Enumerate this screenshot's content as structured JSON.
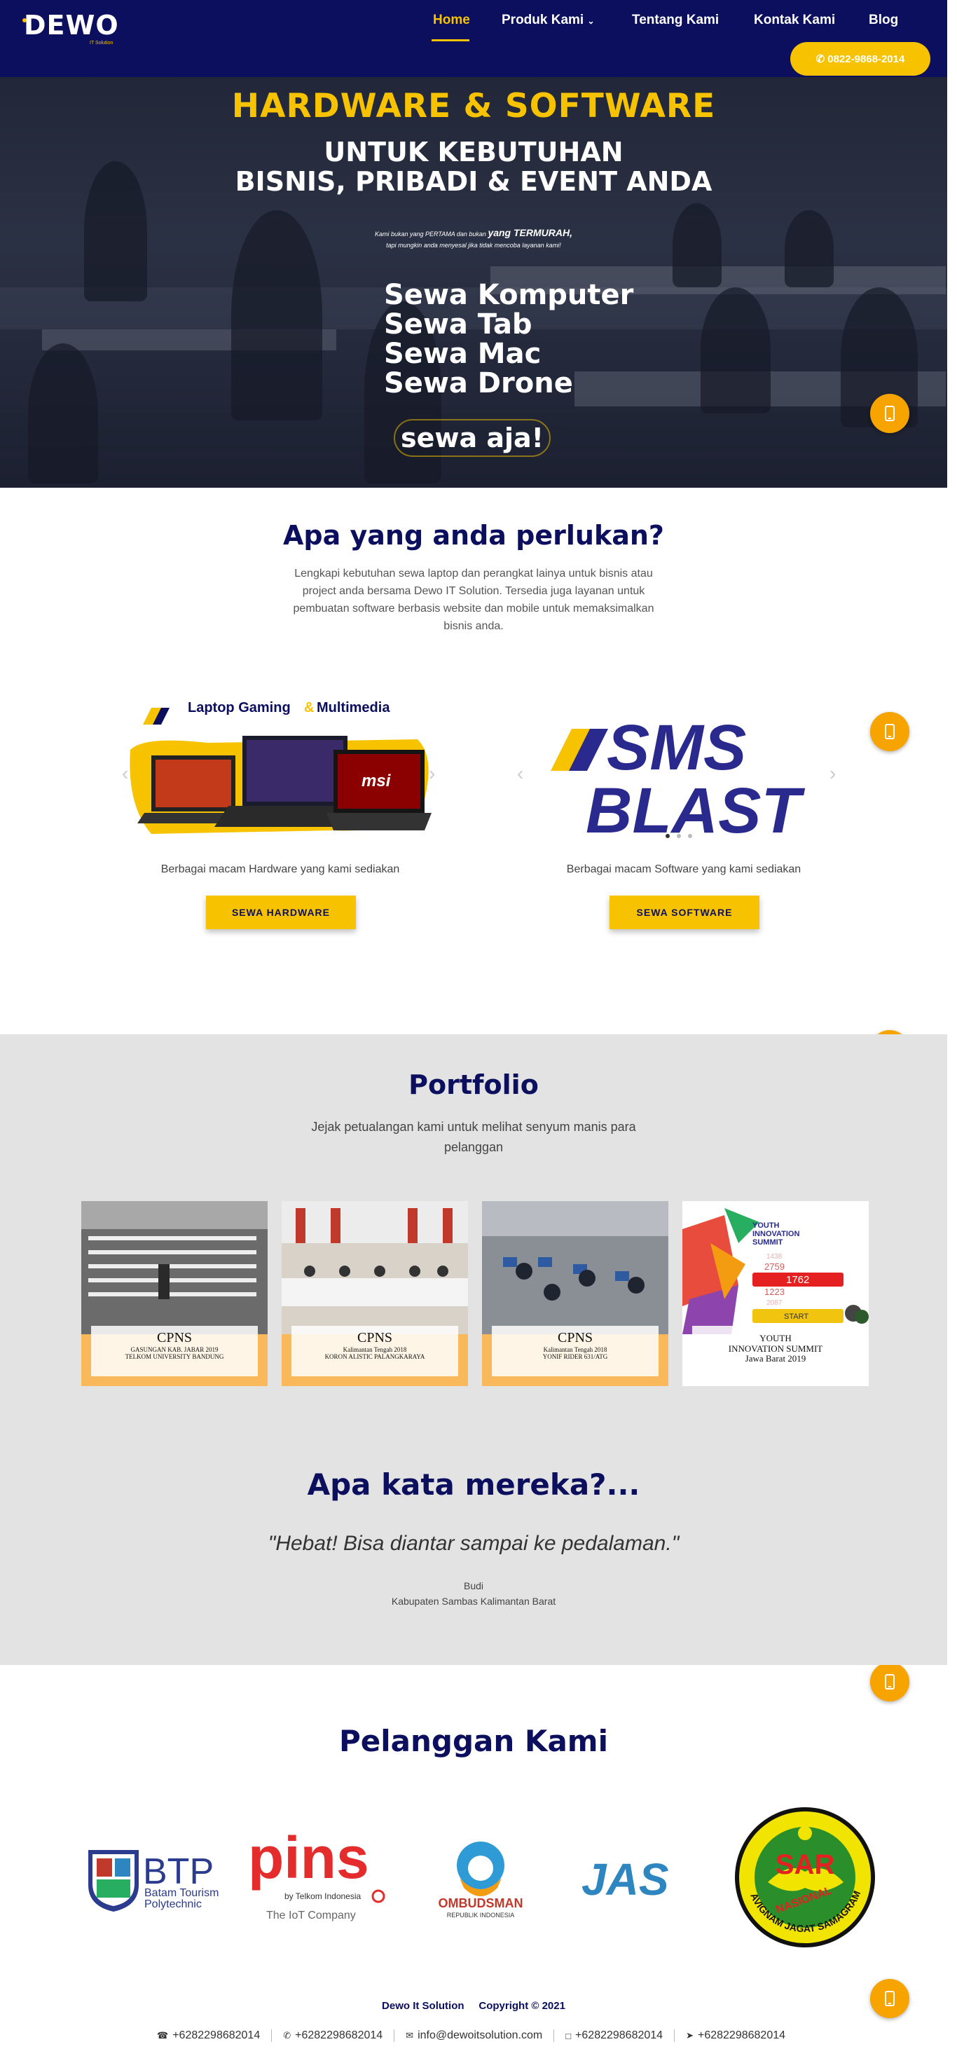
{
  "header": {
    "logo": "DEWO",
    "logo_sub": "IT Solution",
    "nav": [
      "Home",
      "Produk Kami",
      "Tentang Kami",
      "Kontak Kami",
      "Blog"
    ],
    "phone_button": "0822-9868-2014"
  },
  "hero": {
    "title": "HARDWARE & SOFTWARE",
    "subtitle_1": "UNTUK KEBUTUHAN",
    "subtitle_2": "BISNIS, PRIBADI & EVENT ANDA",
    "tagline_1a": "Kami bukan yang PERTAMA dan bukan",
    "tagline_1b": "yang TERMURAH,",
    "tagline_2": "tapi mungkin anda menyesal jika tidak mencoba layanan kami!",
    "rentals": [
      "Sewa Komputer",
      "Sewa Tab",
      "Sewa Mac",
      "Sewa Drone"
    ],
    "cta": "sewa aja!"
  },
  "needs": {
    "title": "Apa yang anda perlukan?",
    "text": "Lengkapi kebutuhan sewa laptop dan perangkat lainya untuk bisnis atau project anda bersama Dewo IT Solution. Tersedia juga layanan untuk pembuatan software berbasis website dan mobile untuk memaksimalkan bisnis anda.",
    "hardware": {
      "banner_title_1": "Laptop Gaming",
      "banner_title_amp": "&",
      "banner_title_2": "Multimedia",
      "desc": "Berbagai macam Hardware yang kami sediakan",
      "button": "SEWA HARDWARE"
    },
    "software": {
      "banner_line_1": "SMS",
      "banner_line_2": "BLAST",
      "desc": "Berbagai macam Software yang kami sediakan",
      "button": "SEWA SOFTWARE"
    }
  },
  "portfolio": {
    "title": "Portfolio",
    "text": "Jejak petualangan kami untuk melihat senyum manis para pelanggan",
    "items": [
      {
        "big": "CPNS",
        "small_1": "GASUNGAN KAB. JABAR 2019",
        "small_2": "TELKOM UNIVERSITY BANDUNG"
      },
      {
        "big": "CPNS",
        "small_1": "Kalimantan Tengah 2018",
        "small_2": "KORON ALISTIC PALANGKARAYA"
      },
      {
        "big": "CPNS",
        "small_1": "Kalimantan Tengah 2018",
        "small_2": "YONIF RIDER 631/ATG"
      },
      {
        "big": "YOUTH",
        "small_1": "INNOVATION SUMMIT",
        "small_2": "Jawa Barat 2019"
      }
    ],
    "yis": {
      "header_1": "YOUTH",
      "header_2": "INNOVATION",
      "header_3": "SUMMIT",
      "n1": "1438",
      "n2": "2759",
      "n3": "1762",
      "n4": "1223",
      "n5": "2087",
      "start": "START"
    }
  },
  "testimonial": {
    "title": "Apa kata mereka?...",
    "quote": "\"Hebat! Bisa diantar sampai ke pedalaman.\"",
    "name": "Budi",
    "location": "Kabupaten Sambas Kalimantan Barat"
  },
  "clients": {
    "title": "Pelanggan Kami",
    "btp_big": "BTP",
    "btp_1": "Batam Tourism",
    "btp_2": "Polytechnic",
    "pins": "pins",
    "pins_by": "by Telkom Indonesia",
    "pins_sub": "The IoT Company",
    "ombudsman": "OMBUDSMAN",
    "ombudsman_sub": "REPUBLIK INDONESIA",
    "jas": "JAS",
    "sar": "SAR",
    "sar_2": "NASIONAL",
    "sar_ring": "AVIGNAM JAGAT SAMAGRAM"
  },
  "footer": {
    "brand": "Dewo It Solution",
    "copyright": "Copyright © 2021",
    "contacts": [
      "+6282298682014",
      "+6282298682014",
      "info@dewoitsolution.com",
      "+6282298682014",
      "+6282298682014"
    ]
  },
  "colors": {
    "navy": "#0b0f5e",
    "accent": "#f7c300",
    "button_orange": "#f7a300",
    "portfolio_bg": "#e3e3e3"
  }
}
